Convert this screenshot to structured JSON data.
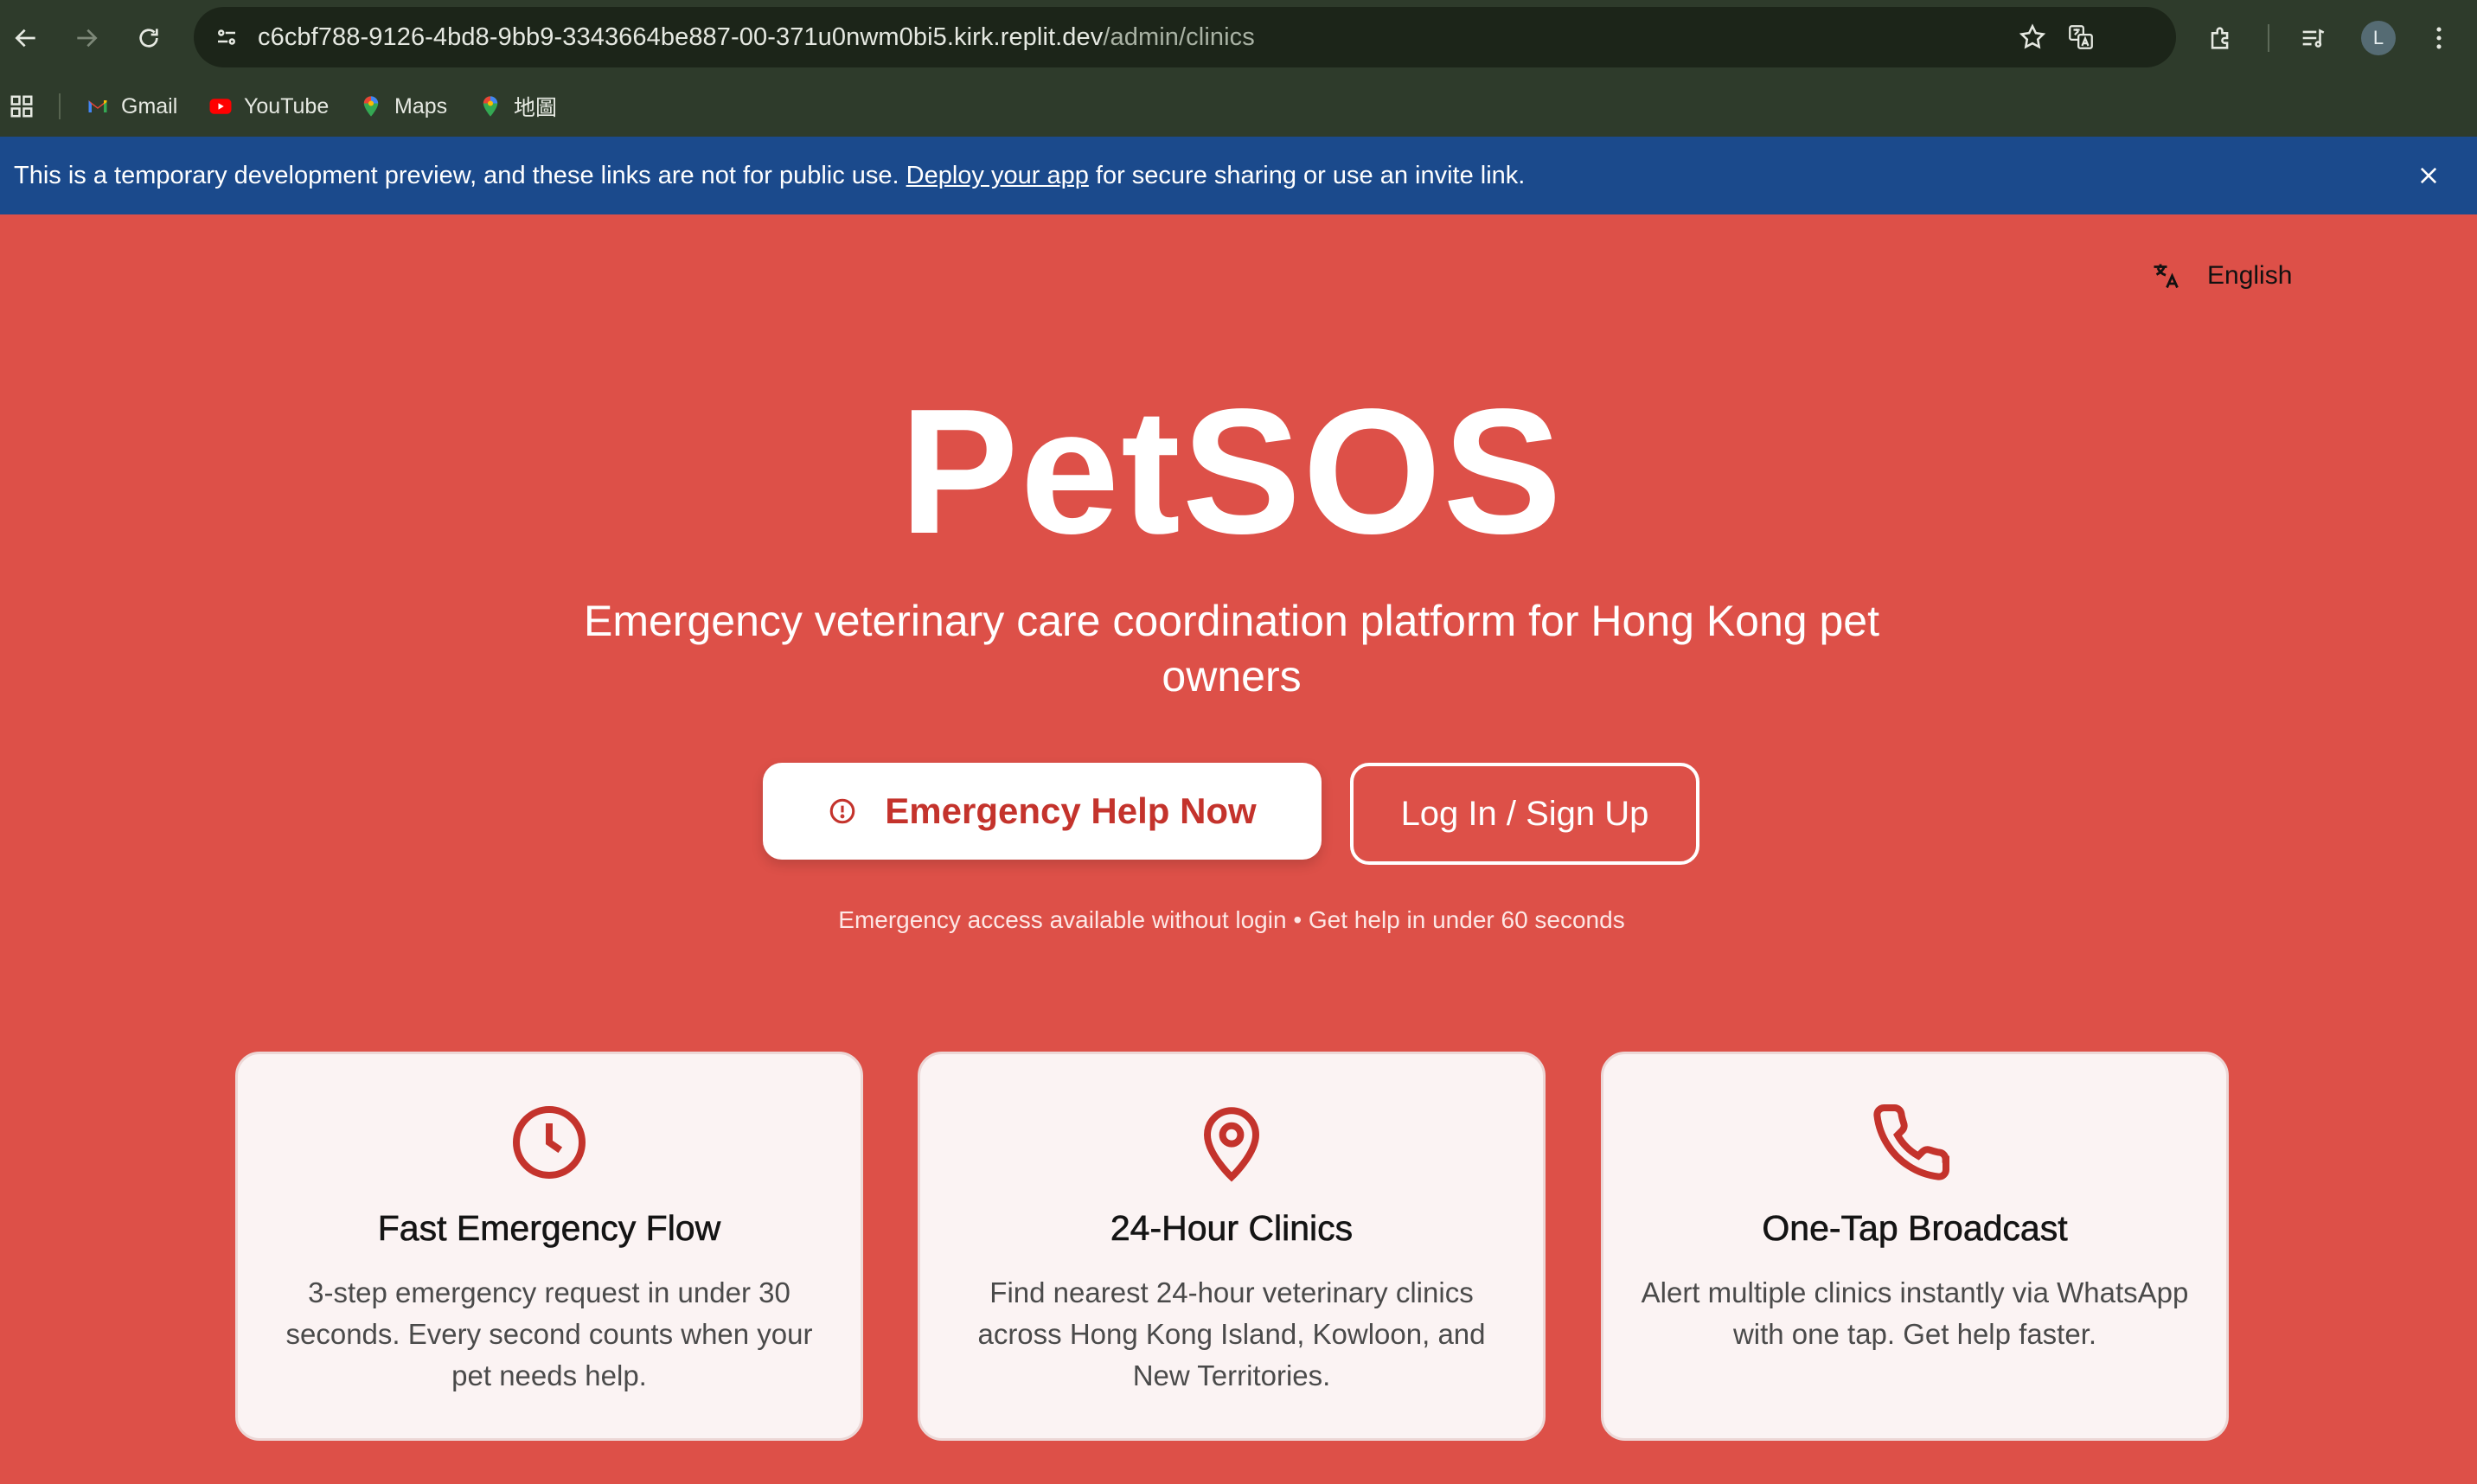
{
  "browser": {
    "url_host": "c6cbf788-9126-4bd8-9bb9-3343664be887-00-371u0nwm0bi5.kirk.replit.dev",
    "url_path": "/admin/clinics",
    "avatar_letter": "L",
    "bookmarks": [
      {
        "label": "Gmail",
        "icon": "gmail-icon"
      },
      {
        "label": "YouTube",
        "icon": "youtube-icon"
      },
      {
        "label": "Maps",
        "icon": "maps-icon"
      },
      {
        "label": "地圖",
        "icon": "maps-icon"
      }
    ]
  },
  "banner": {
    "text_before": "This is a temporary development preview, and these links are not for public use. ",
    "link": "Deploy your app",
    "text_after": " for secure sharing or use an invite link."
  },
  "language": {
    "label": "English",
    "icon": "translate-icon"
  },
  "hero": {
    "title": "PetSOS",
    "subtitle": "Emergency veterinary care coordination platform for Hong Kong pet owners",
    "emergency_button": "Emergency Help Now",
    "login_button": "Log In / Sign Up",
    "note": "Emergency access available without login • Get help in under 60 seconds"
  },
  "features": [
    {
      "icon": "clock-icon",
      "title": "Fast Emergency Flow",
      "text": "3-step emergency request in under 30 seconds. Every second counts when your pet needs help."
    },
    {
      "icon": "map-pin-icon",
      "title": "24-Hour Clinics",
      "text": "Find nearest 24-hour veterinary clinics across Hong Kong Island, Kowloon, and New Territories."
    },
    {
      "icon": "phone-icon",
      "title": "One-Tap Broadcast",
      "text": "Alert multiple clinics instantly via WhatsApp with one tap. Get help faster."
    }
  ],
  "colors": {
    "page_background": "#dd5048",
    "accent_red": "#c4332c",
    "banner_blue": "#1b4a8c",
    "browser_chrome": "#2e3b2b"
  }
}
